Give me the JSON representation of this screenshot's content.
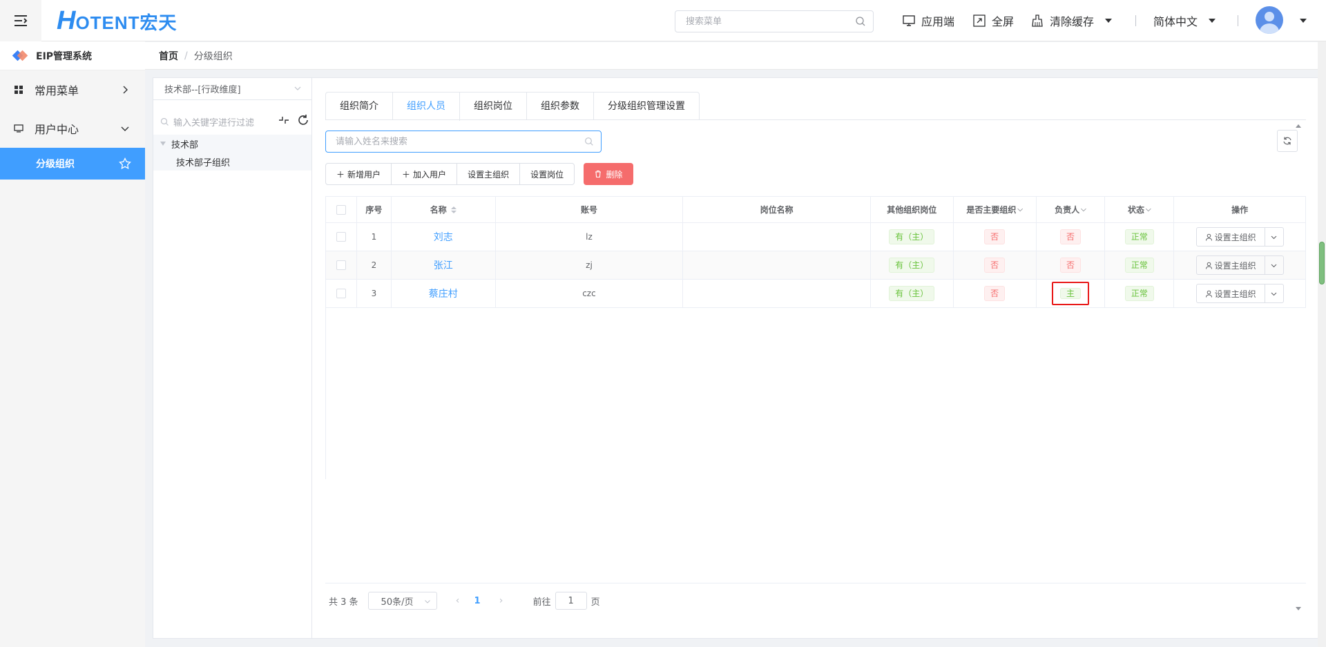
{
  "header": {
    "logo_h": "H",
    "logo_rest": "OTENT宏天",
    "search_placeholder": "搜索菜单",
    "nav": {
      "app": "应用端",
      "fullscreen": "全屏",
      "clear_cache": "清除缓存",
      "language": "简体中文"
    }
  },
  "sidebar": {
    "brand": "EIP管理系统",
    "items": [
      {
        "label": "常用菜单",
        "icon": "grid-icon"
      },
      {
        "label": "用户中心",
        "icon": "monitor-icon"
      },
      {
        "label": "分级组织",
        "icon": "star-icon"
      }
    ]
  },
  "breadcrumb": {
    "home": "首页",
    "separator": "/",
    "current": "分级组织"
  },
  "tree": {
    "dimension": "技术部--[行政维度]",
    "filter_placeholder": "输入关键字进行过滤",
    "nodes": [
      "技术部",
      "技术部子组织"
    ]
  },
  "tabs": [
    "组织简介",
    "组织人员",
    "组织岗位",
    "组织参数",
    "分级组织管理设置"
  ],
  "active_tab": "组织人员",
  "name_search_placeholder": "请输入姓名来搜索",
  "buttons": {
    "add_user": "新增用户",
    "join_user": "加入用户",
    "set_main_org": "设置主组织",
    "set_post": "设置岗位",
    "delete": "删除"
  },
  "table": {
    "headers": {
      "index": "序号",
      "name": "名称",
      "account": "账号",
      "post": "岗位名称",
      "other_post": "其他组织岗位",
      "is_main": "是否主要组织",
      "leader": "负责人",
      "status": "状态",
      "op": "操作"
    },
    "rows": [
      {
        "index": "1",
        "name": "刘志",
        "account": "lz",
        "post": "",
        "other_post": "有（主）",
        "is_main": "否",
        "leader": "否",
        "status": "正常",
        "op": "设置主组织"
      },
      {
        "index": "2",
        "name": "张江",
        "account": "zj",
        "post": "",
        "other_post": "有（主）",
        "is_main": "否",
        "leader": "否",
        "status": "正常",
        "op": "设置主组织"
      },
      {
        "index": "3",
        "name": "蔡庄村",
        "account": "czc",
        "post": "",
        "other_post": "有（主）",
        "is_main": "否",
        "leader": "主",
        "status": "正常",
        "op": "设置主组织"
      }
    ]
  },
  "pagination": {
    "total": "共 3 条",
    "page_size": "50条/页",
    "current": "1",
    "goto_label": "前往",
    "goto_value": "1",
    "page_unit": "页"
  },
  "colors": {
    "primary": "#409eff",
    "danger": "#f56c6c",
    "success": "#67c23a",
    "highlight": "#e81818"
  }
}
